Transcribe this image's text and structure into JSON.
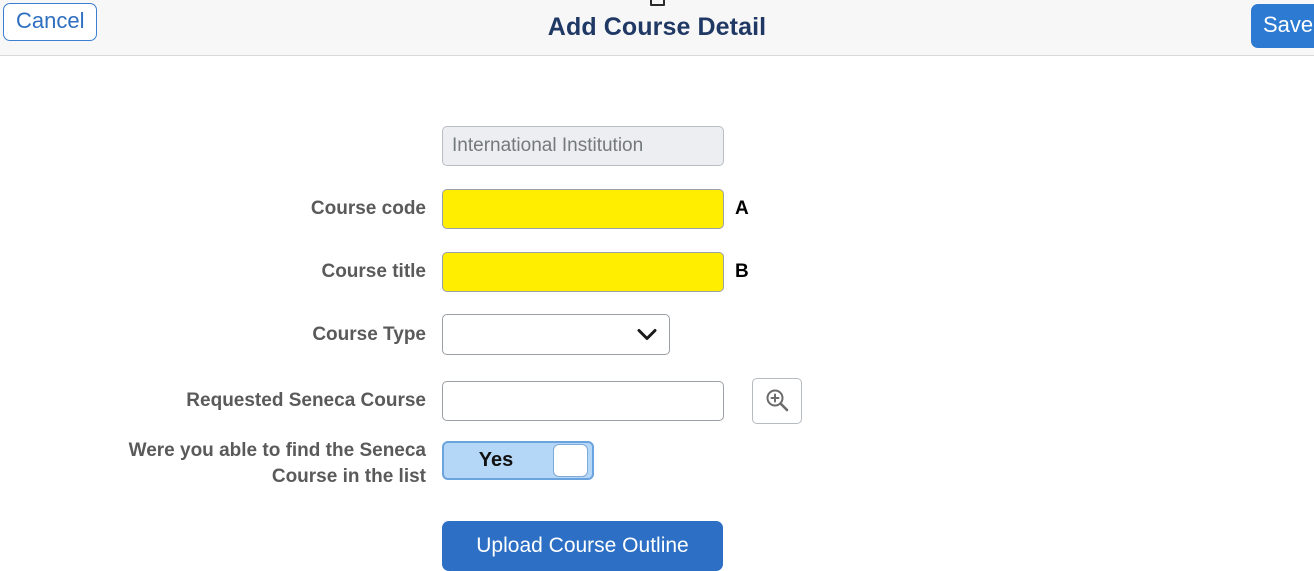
{
  "header": {
    "title": "Add Course Detail",
    "cancel_label": "Cancel",
    "save_label": "Save"
  },
  "form": {
    "institution": {
      "value": "International Institution",
      "placeholder": "International Institution",
      "readonly": true
    },
    "course_code": {
      "label": "Course code",
      "value": "",
      "placeholder": "",
      "marker": "A",
      "highlighted": true,
      "highlight_color": "#ffee00"
    },
    "course_title": {
      "label": "Course title",
      "value": "",
      "placeholder": "",
      "marker": "B",
      "highlighted": true,
      "highlight_color": "#ffee00"
    },
    "course_type": {
      "label": "Course Type",
      "selected": "",
      "options": [
        ""
      ]
    },
    "requested_seneca_course": {
      "label": "Requested Seneca Course",
      "value": "",
      "placeholder": "",
      "search_icon": "zoom-in-magnifier-icon"
    },
    "found_course_toggle": {
      "label_line1": "Were you able to find the Seneca",
      "label_line2": "Course in the list",
      "state_label": "Yes",
      "on": true,
      "track_color": "#b5d7f7"
    },
    "upload_button_label": "Upload Course Outline"
  },
  "colors": {
    "header_bg": "#f7f7f7",
    "title": "#1f3864",
    "primary_blue": "#2c7ad1",
    "label_gray": "#5a5a5a"
  }
}
